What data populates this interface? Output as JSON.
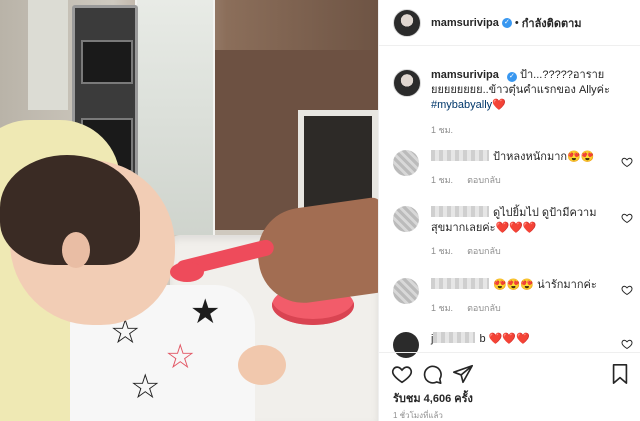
{
  "post": {
    "username": "mamsurivipa",
    "verified_badge": "✓",
    "separator": "•",
    "follow_status": "กำลังติดตาม"
  },
  "caption": {
    "username": "mamsurivipa",
    "text": "ป้า...?????อารายยยยยยยยย..ข้าวตุ๋นคำแรกของ Allyค่ะ",
    "hashtag": "#mybabyally",
    "emoji": "❤️",
    "time": "1 ชม."
  },
  "comments": [
    {
      "text": "ป้าหลงหนักมาก😍😍",
      "time": "1 ชม.",
      "reply_label": "ตอบกลับ"
    },
    {
      "text": "ดูไปยิ้มไป ดูป้ามีความสุขมากเลยค่ะ❤️❤️❤️",
      "time": "1 ชม.",
      "reply_label": "ตอบกลับ"
    },
    {
      "text": "😍😍😍 น่ารักมากค่ะ",
      "time": "1 ชม.",
      "reply_label": "ตอบกลับ"
    },
    {
      "name_prefix": "j",
      "name_suffix": "b",
      "text": "❤️❤️❤️"
    }
  ],
  "footer": {
    "likes": "รับชม 4,606 ครั้ง",
    "posted": "1 ชั่วโมงที่แล้ว"
  },
  "colors": {
    "link": "#00376b",
    "verified": "#3897f0",
    "muted": "#8e8e8e"
  },
  "icons": [
    "heart-icon",
    "comment-icon",
    "share-icon",
    "bookmark-icon"
  ]
}
